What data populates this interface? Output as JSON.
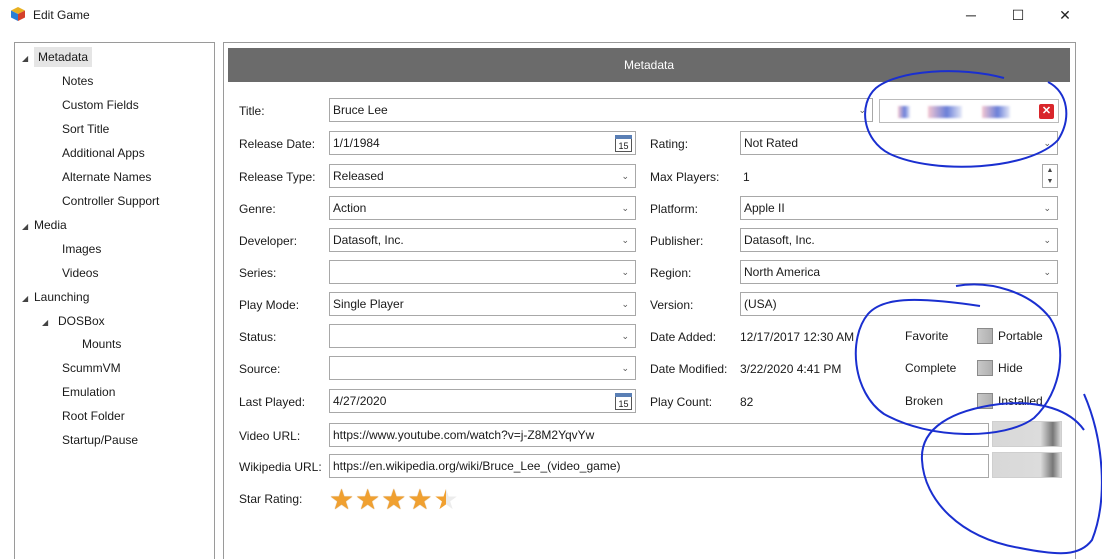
{
  "window": {
    "title": "Edit Game",
    "minimize": "─",
    "maximize": "☐",
    "close": "✕"
  },
  "sidebar": {
    "items": [
      {
        "label": "Metadata"
      },
      {
        "label": "Notes"
      },
      {
        "label": "Custom Fields"
      },
      {
        "label": "Sort Title"
      },
      {
        "label": "Additional Apps"
      },
      {
        "label": "Alternate Names"
      },
      {
        "label": "Controller Support"
      },
      {
        "label": "Media"
      },
      {
        "label": "Images"
      },
      {
        "label": "Videos"
      },
      {
        "label": "Launching"
      },
      {
        "label": "DOSBox"
      },
      {
        "label": "Mounts"
      },
      {
        "label": "ScummVM"
      },
      {
        "label": "Emulation"
      },
      {
        "label": "Root Folder"
      },
      {
        "label": "Startup/Pause"
      }
    ],
    "expander": "◢"
  },
  "header": {
    "title": "Metadata"
  },
  "form": {
    "title_label": "Title:",
    "title_value": "Bruce Lee",
    "release_date_label": "Release Date:",
    "release_date_value": "1/1/1984",
    "release_type_label": "Release Type:",
    "release_type_value": "Released",
    "genre_label": "Genre:",
    "genre_value": "Action",
    "developer_label": "Developer:",
    "developer_value": "Datasoft, Inc.",
    "series_label": "Series:",
    "series_value": "",
    "play_mode_label": "Play Mode:",
    "play_mode_value": "Single Player",
    "status_label": "Status:",
    "status_value": "",
    "source_label": "Source:",
    "source_value": "",
    "last_played_label": "Last Played:",
    "last_played_value": "4/27/2020",
    "video_url_label": "Video URL:",
    "video_url_value": "https://www.youtube.com/watch?v=j-Z8M2YqvYw",
    "wikipedia_url_label": "Wikipedia URL:",
    "wikipedia_url_value": "https://en.wikipedia.org/wiki/Bruce_Lee_(video_game)",
    "star_rating_label": "Star Rating:",
    "star_rating": 4.5,
    "star_max": 5,
    "rating_label": "Rating:",
    "rating_value": "Not Rated",
    "max_players_label": "Max Players:",
    "max_players_value": "1",
    "platform_label": "Platform:",
    "platform_value": "Apple II",
    "publisher_label": "Publisher:",
    "publisher_value": "Datasoft, Inc.",
    "region_label": "Region:",
    "region_value": "North America",
    "version_label": "Version:",
    "version_value": "(USA)",
    "date_added_label": "Date Added:",
    "date_added_value": "12/17/2017 12:30 AM",
    "date_modified_label": "Date Modified:",
    "date_modified_value": "3/22/2020 4:41 PM",
    "play_count_label": "Play Count:",
    "play_count_value": "82",
    "calendar_day": "15"
  },
  "flags": {
    "favorite_label": "Favorite",
    "complete_label": "Complete",
    "broken_label": "Broken",
    "portable_label": "Portable",
    "hide_label": "Hide",
    "installed_label": "Installed"
  },
  "icons": {
    "combo_arrow": "⌄",
    "spin_up": "▲",
    "spin_down": "▼",
    "clear": "✕",
    "star": "★"
  },
  "colors": {
    "header_bg": "#6b6b6b",
    "star": "#f0a030",
    "annotation_ink": "#1a2fd0",
    "clear_button": "#d9262b"
  }
}
